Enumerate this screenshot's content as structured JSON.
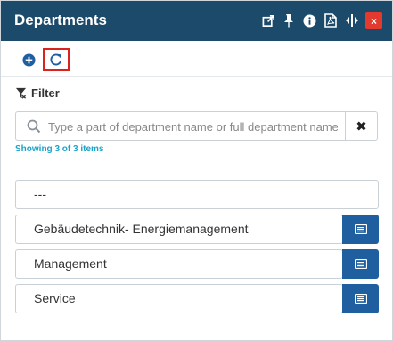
{
  "window": {
    "title": "Departments",
    "accent_color": "#1c4a6b",
    "close_color": "#e23a2e",
    "close_label": "×",
    "title_icons": [
      "external-link-icon",
      "pin-icon",
      "info-icon",
      "pdf-icon",
      "resize-horizontal-icon"
    ]
  },
  "toolbar": {
    "buttons": [
      "add-icon",
      "refresh-icon"
    ]
  },
  "filter": {
    "label": "Filter",
    "search_placeholder": "Type a part of department name or full department name",
    "search_value": "",
    "clear_label": "✖",
    "showing_text": "Showing 3 of 3 items"
  },
  "departments": [
    {
      "name": "---",
      "has_detail": false
    },
    {
      "name": "Gebäudetechnik- Energiemanagement",
      "has_detail": true
    },
    {
      "name": "Management",
      "has_detail": true
    },
    {
      "name": "Service",
      "has_detail": true
    }
  ]
}
